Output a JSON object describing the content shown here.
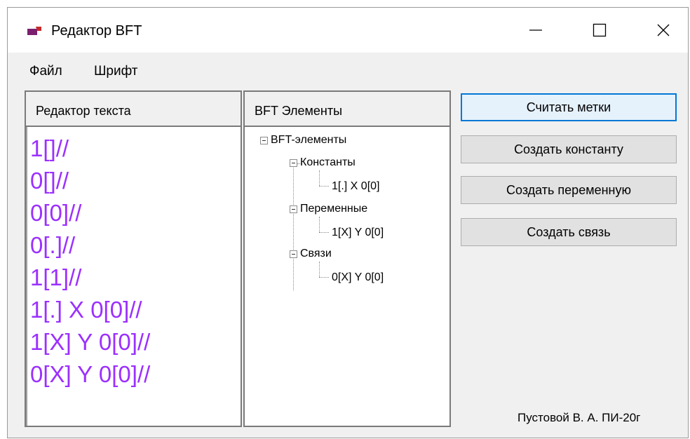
{
  "window": {
    "title": "Редактор BFT",
    "icon": "app-icon",
    "controls": [
      "minimize-icon",
      "maximize-icon",
      "close-icon"
    ]
  },
  "menu": {
    "items": [
      {
        "label": "Файл"
      },
      {
        "label": "Шрифт"
      }
    ]
  },
  "text_editor": {
    "header": "Редактор текста",
    "lines": [
      "1[]//",
      "0[]//",
      "0[0]//",
      "0[.]//",
      "1[1]//",
      "1[.] X 0[0]//",
      "1[X] Y 0[0]//",
      "0[X] Y 0[0]//"
    ],
    "text_color": "#9b30ff"
  },
  "tree_panel": {
    "header": "BFT Элементы",
    "root": "BFT-элементы",
    "groups": [
      {
        "label": "Константы",
        "children": [
          "1[.] X 0[0]"
        ]
      },
      {
        "label": "Переменные",
        "children": [
          "1[X] Y 0[0]"
        ]
      },
      {
        "label": "Связи",
        "children": [
          "0[X] Y 0[0]"
        ]
      }
    ]
  },
  "buttons": {
    "read_labels": "Считать метки",
    "create_constant": "Создать константу",
    "create_variable": "Создать переменную",
    "create_link": "Создать связь"
  },
  "footer": {
    "author": "Пустовой В. А. ПИ-20г"
  },
  "colors": {
    "accent": "#0078d7",
    "window_bg": "#f0f0f0",
    "button_bg": "#e1e1e1",
    "icon_purple": "#7a1f6e"
  }
}
